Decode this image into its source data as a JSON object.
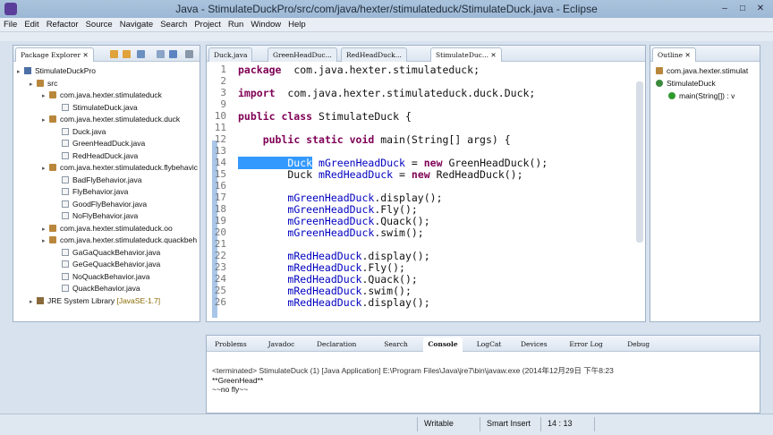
{
  "window": {
    "title": "Java - StimulateDuckPro/src/com/java/hexter/stimulateduck/StimulateDuck.java - Eclipse"
  },
  "menu": [
    "File",
    "Edit",
    "Refactor",
    "Source",
    "Navigate",
    "Search",
    "Project",
    "Run",
    "Window",
    "Help"
  ],
  "package_explorer": {
    "tab": "Package Explorer",
    "tree": [
      {
        "label": "StimulateDuckPro",
        "depth": 0,
        "icon": "project-icon"
      },
      {
        "label": "src",
        "depth": 1,
        "icon": "folder-icon"
      },
      {
        "label": "com.java.hexter.stimulateduck",
        "depth": 2,
        "icon": "package-icon"
      },
      {
        "label": "StimulateDuck.java",
        "depth": 3,
        "icon": "java-file-icon"
      },
      {
        "label": "com.java.hexter.stimulateduck.duck",
        "depth": 2,
        "icon": "package-icon"
      },
      {
        "label": "Duck.java",
        "depth": 3,
        "icon": "java-file-icon"
      },
      {
        "label": "GreenHeadDuck.java",
        "depth": 3,
        "icon": "java-file-icon"
      },
      {
        "label": "RedHeadDuck.java",
        "depth": 3,
        "icon": "java-file-icon"
      },
      {
        "label": "com.java.hexter.stimulateduck.flybehavic",
        "depth": 2,
        "icon": "package-icon"
      },
      {
        "label": "BadFlyBehavior.java",
        "depth": 3,
        "icon": "java-file-icon"
      },
      {
        "label": "FlyBehavior.java",
        "depth": 3,
        "icon": "java-file-icon"
      },
      {
        "label": "GoodFlyBehavior.java",
        "depth": 3,
        "icon": "java-file-icon"
      },
      {
        "label": "NoFlyBehavior.java",
        "depth": 3,
        "icon": "java-file-icon"
      },
      {
        "label": "com.java.hexter.stimulateduck.oo",
        "depth": 2,
        "icon": "package-icon"
      },
      {
        "label": "com.java.hexter.stimulateduck.quackbeh",
        "depth": 2,
        "icon": "package-icon"
      },
      {
        "label": "GaGaQuackBehavior.java",
        "depth": 3,
        "icon": "java-file-icon"
      },
      {
        "label": "GeGeQuackBehavior.java",
        "depth": 3,
        "icon": "java-file-icon"
      },
      {
        "label": "NoQuackBehavior.java",
        "depth": 3,
        "icon": "java-file-icon"
      },
      {
        "label": "QuackBehavior.java",
        "depth": 3,
        "icon": "java-file-icon"
      },
      {
        "label": "JRE System Library",
        "suffix": "[JavaSE-1.7]",
        "depth": 1,
        "icon": "library-icon"
      }
    ]
  },
  "editor": {
    "tabs": [
      "Duck.java",
      "GreenHeadDuc...",
      "RedHeadDuck...",
      "StimulateDuc..."
    ],
    "active_tab": 3,
    "lines": [
      {
        "n": "1",
        "parts": [
          [
            "kw",
            "package"
          ],
          [
            "",
            "  com.java.hexter.stimulateduck;"
          ]
        ]
      },
      {
        "n": "2",
        "parts": []
      },
      {
        "n": "3",
        "parts": [
          [
            "kw",
            "import"
          ],
          [
            "",
            "  com.java.hexter.stimulateduck.duck.Duck;"
          ]
        ]
      },
      {
        "n": "9",
        "parts": []
      },
      {
        "n": "10",
        "parts": [
          [
            "kw",
            "public class"
          ],
          [
            "",
            " StimulateDuck {"
          ]
        ]
      },
      {
        "n": "11",
        "parts": []
      },
      {
        "n": "12",
        "parts": [
          [
            "",
            "    "
          ],
          [
            "kw",
            "public static void"
          ],
          [
            "",
            " main(String[] args) {"
          ]
        ]
      },
      {
        "n": "13",
        "parts": []
      },
      {
        "n": "14",
        "parts": [
          [
            "sel",
            "        Duck"
          ],
          [
            "",
            " "
          ],
          [
            "vr",
            "mGreenHeadDuck"
          ],
          [
            "",
            " = "
          ],
          [
            "kw",
            "new"
          ],
          [
            "",
            " GreenHeadDuck();"
          ]
        ]
      },
      {
        "n": "15",
        "parts": [
          [
            "",
            "        Duck "
          ],
          [
            "vr",
            "mRedHeadDuck"
          ],
          [
            "",
            " = "
          ],
          [
            "kw",
            "new"
          ],
          [
            "",
            " RedHeadDuck();"
          ]
        ]
      },
      {
        "n": "16",
        "parts": []
      },
      {
        "n": "17",
        "parts": [
          [
            "",
            "        "
          ],
          [
            "vr",
            "mGreenHeadDuck"
          ],
          [
            "",
            ".display();"
          ]
        ]
      },
      {
        "n": "18",
        "parts": [
          [
            "",
            "        "
          ],
          [
            "vr",
            "mGreenHeadDuck"
          ],
          [
            "",
            ".Fly();"
          ]
        ]
      },
      {
        "n": "19",
        "parts": [
          [
            "",
            "        "
          ],
          [
            "vr",
            "mGreenHeadDuck"
          ],
          [
            "",
            ".Quack();"
          ]
        ]
      },
      {
        "n": "20",
        "parts": [
          [
            "",
            "        "
          ],
          [
            "vr",
            "mGreenHeadDuck"
          ],
          [
            "",
            ".swim();"
          ]
        ]
      },
      {
        "n": "21",
        "parts": []
      },
      {
        "n": "22",
        "parts": [
          [
            "",
            "        "
          ],
          [
            "vr",
            "mRedHeadDuck"
          ],
          [
            "",
            ".display();"
          ]
        ]
      },
      {
        "n": "23",
        "parts": [
          [
            "",
            "        "
          ],
          [
            "vr",
            "mRedHeadDuck"
          ],
          [
            "",
            ".Fly();"
          ]
        ]
      },
      {
        "n": "24",
        "parts": [
          [
            "",
            "        "
          ],
          [
            "vr",
            "mRedHeadDuck"
          ],
          [
            "",
            ".Quack();"
          ]
        ]
      },
      {
        "n": "25",
        "parts": [
          [
            "",
            "        "
          ],
          [
            "vr",
            "mRedHeadDuck"
          ],
          [
            "",
            ".swim();"
          ]
        ]
      },
      {
        "n": "26",
        "parts": [
          [
            "",
            "        "
          ],
          [
            "vr",
            "mRedHeadDuck"
          ],
          [
            "",
            ".display();"
          ]
        ]
      }
    ]
  },
  "outline": {
    "tab": "Outline",
    "items": [
      {
        "label": "com.java.hexter.stimulat",
        "depth": 0,
        "icon": "package-icon"
      },
      {
        "label": "StimulateDuck",
        "depth": 0,
        "icon": "class-icon"
      },
      {
        "label": "main(String[]) : v",
        "depth": 1,
        "icon": "method-icon"
      }
    ]
  },
  "bottom_panel": {
    "tabs": [
      "Problems",
      "Javadoc",
      "Declaration",
      "Search",
      "Console",
      "LogCat",
      "Devices",
      "Error Log",
      "Debug"
    ],
    "active_tab": 4,
    "console_header": "<terminated> StimulateDuck (1) [Java Application] E:\\Program Files\\Java\\jre7\\bin\\javaw.exe (2014年12月29日 下午8:23",
    "output": [
      "**GreenHead**",
      "~~no fly~~"
    ]
  },
  "status": {
    "mode": "Writable",
    "insert": "Smart Insert",
    "position": "14 : 13"
  },
  "colors": {
    "keyword": "#7f0055",
    "field": "#0000c0",
    "selection": "#3399ff"
  }
}
